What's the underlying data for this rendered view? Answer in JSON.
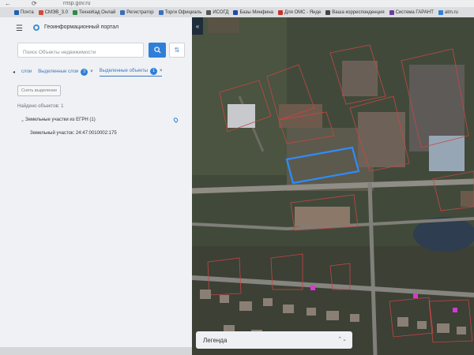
{
  "browser": {
    "back": "←",
    "reload": "⟳",
    "url": "rnsp.gov.ru",
    "bookmarks": [
      {
        "label": "Почта",
        "color": "#1e62b0"
      },
      {
        "label": "СМЭВ_3.0",
        "color": "#d24b3c"
      },
      {
        "label": "ТехноКад Онлай",
        "color": "#2f8a4a"
      },
      {
        "label": "Регистратор",
        "color": "#3a6fb5"
      },
      {
        "label": "Торги Официаль",
        "color": "#3b6fc1"
      },
      {
        "label": "ИСОГД",
        "color": "#555555"
      },
      {
        "label": "Базы Минфина",
        "color": "#1f4aa8"
      },
      {
        "label": "Для ОМС - Янде",
        "color": "#c9312a"
      },
      {
        "label": "Ваша корреспонденция",
        "color": "#444444"
      },
      {
        "label": "Система ГАРАНТ",
        "color": "#6b3c9f"
      },
      {
        "label": "atm.ru",
        "color": "#2f7fd8"
      }
    ]
  },
  "sidebar": {
    "title": "Геоинформационный портал",
    "search_placeholder": "Поиск Объекты недвижимости",
    "tabs": [
      {
        "label": "слои",
        "badge": "",
        "active": false
      },
      {
        "label": "Выделенные слои",
        "badge": "3",
        "active": false
      },
      {
        "label": "Выделенные объекты",
        "badge": "1",
        "active": true
      }
    ],
    "clear_label": "Снять выделение",
    "found": "Найдено объектов: 1",
    "group": "Земельные участки из ЕГРН (1)",
    "item": "Земельный участок: 24:47:0010002:175"
  },
  "map": {
    "legend_label": "Легенда",
    "highlight_color": "#2e8cff"
  }
}
